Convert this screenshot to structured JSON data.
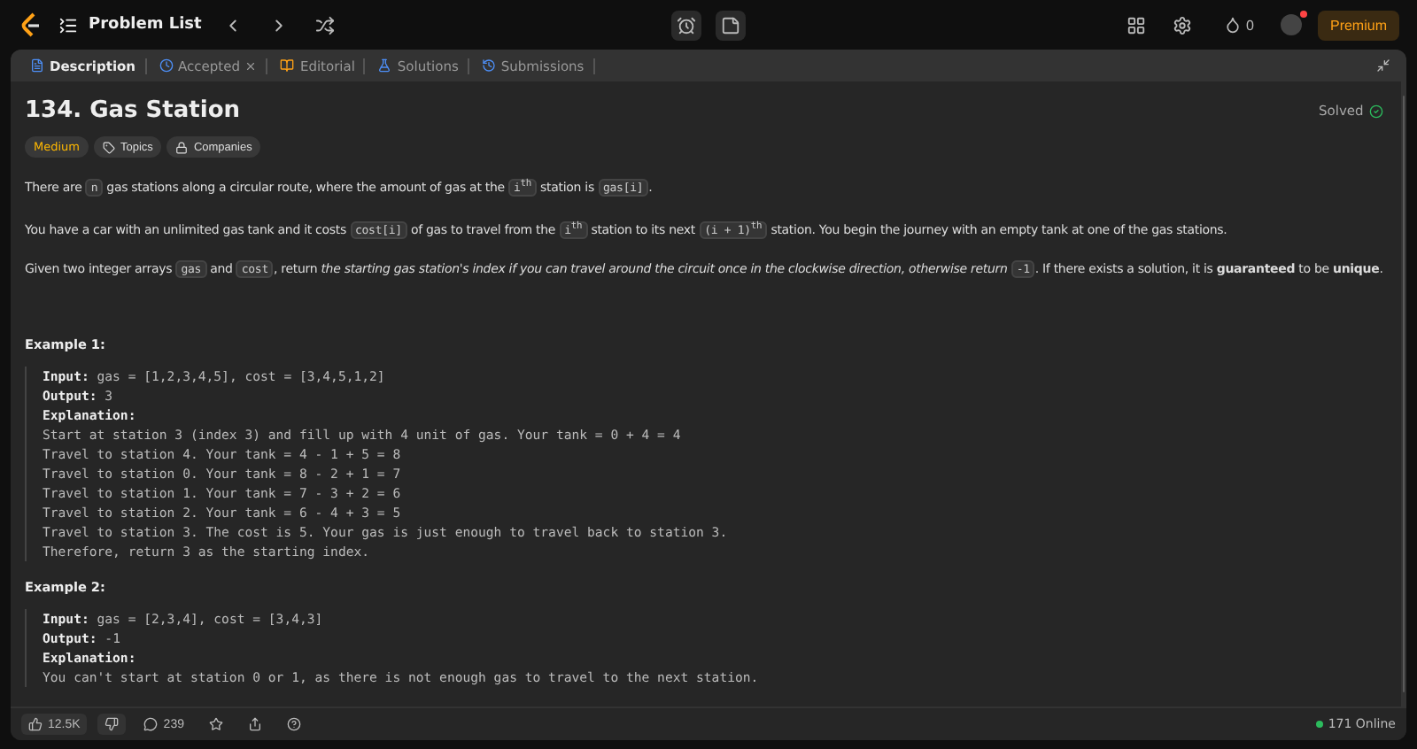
{
  "topbar": {
    "title": "Problem List",
    "streak": "0",
    "premium": "Premium"
  },
  "tabs": [
    {
      "label": "Description",
      "selected": true,
      "closable": false
    },
    {
      "label": "Accepted",
      "selected": false,
      "closable": true
    },
    {
      "label": "Editorial",
      "selected": false,
      "closable": false
    },
    {
      "label": "Solutions",
      "selected": false,
      "closable": false
    },
    {
      "label": "Submissions",
      "selected": false,
      "closable": false
    }
  ],
  "problem": {
    "title": "134. Gas Station",
    "status": "Solved",
    "difficulty": "Medium",
    "tags": [
      "Topics",
      "Companies"
    ]
  },
  "paragraphs": [
    [
      {
        "kind": "text",
        "text": "There are "
      },
      {
        "kind": "code",
        "text": "n"
      },
      {
        "kind": "text",
        "text": " gas stations along a circular route, where the amount of gas at the "
      },
      {
        "kind": "code",
        "text": "i$^{th}$"
      },
      {
        "kind": "text",
        "text": " station is "
      },
      {
        "kind": "code",
        "text": "gas[i]"
      },
      {
        "kind": "text",
        "text": "."
      }
    ],
    [
      {
        "kind": "text",
        "text": "You have a car with an unlimited gas tank and it costs "
      },
      {
        "kind": "code",
        "text": "cost[i]"
      },
      {
        "kind": "text",
        "text": " of gas to travel from the "
      },
      {
        "kind": "code",
        "text": "i$^{th}$"
      },
      {
        "kind": "text",
        "text": " station to its next "
      },
      {
        "kind": "code",
        "text": "(i + 1)$^{th}$"
      },
      {
        "kind": "text",
        "text": " station. You begin the journey with an empty tank at one of the gas stations."
      }
    ],
    [
      {
        "kind": "text",
        "text": "Given two integer arrays "
      },
      {
        "kind": "code",
        "text": "gas"
      },
      {
        "kind": "text",
        "text": " and "
      },
      {
        "kind": "code",
        "text": "cost"
      },
      {
        "kind": "text",
        "text": ", return *the starting gas station's index if you can travel around the circuit once in the clockwise direction, otherwise return* "
      },
      {
        "kind": "code",
        "text": "-1"
      },
      {
        "kind": "text",
        "text": ". If there exists a solution, it is **guaranteed** to be **unique**."
      }
    ]
  ],
  "examples": [
    {
      "heading": "Example 1:",
      "input_label": "Input:",
      "input": "gas = [1,2,3,4,5], cost = [3,4,5,1,2]",
      "output_label": "Output:",
      "output": "3",
      "explanation_label": "Explanation:",
      "explanation": [
        "Start at station 3 (index 3) and fill up with 4 unit of gas. Your tank = 0 + 4 = 4",
        "Travel to station 4. Your tank = 4 - 1 + 5 = 8",
        "Travel to station 0. Your tank = 8 - 2 + 1 = 7",
        "Travel to station 1. Your tank = 7 - 3 + 2 = 6",
        "Travel to station 2. Your tank = 6 - 4 + 3 = 5",
        "Travel to station 3. The cost is 5. Your gas is just enough to travel back to station 3.",
        "Therefore, return 3 as the starting index."
      ]
    },
    {
      "heading": "Example 2:",
      "input_label": "Input:",
      "input": "gas = [2,3,4], cost = [3,4,3]",
      "output_label": "Output:",
      "output": "-1",
      "explanation_label": "Explanation:",
      "explanation": [
        "You can't start at station 0 or 1, as there is not enough gas to travel to the next station."
      ]
    }
  ],
  "footer": {
    "likes": "12.5K",
    "comments": "239",
    "online": "171 Online"
  }
}
